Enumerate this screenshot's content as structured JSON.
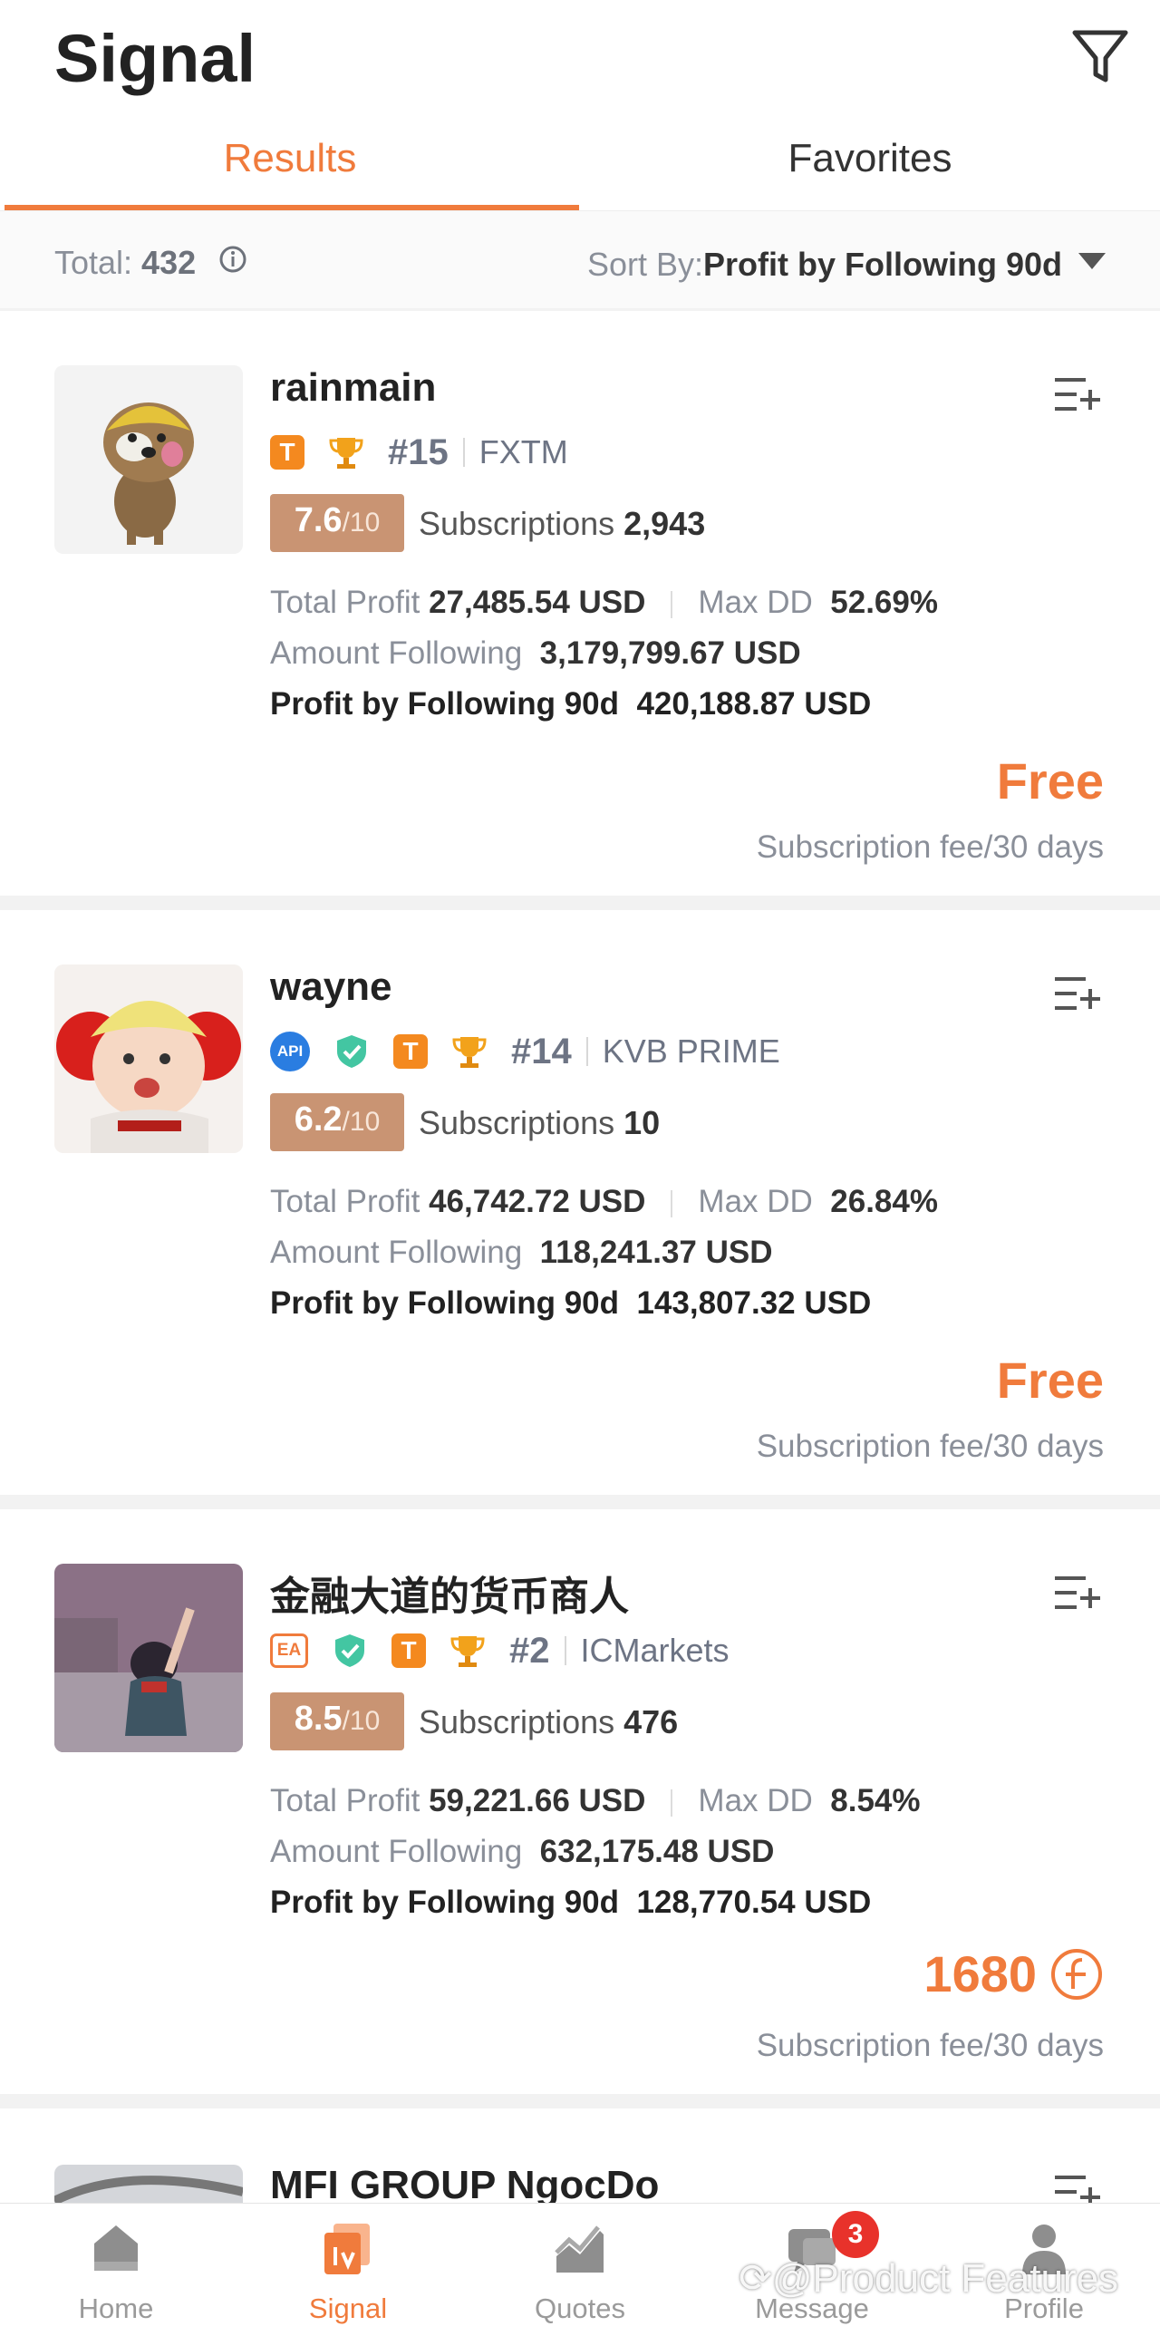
{
  "header": {
    "title": "Signal"
  },
  "tabs": [
    {
      "label": "Results",
      "active": true
    },
    {
      "label": "Favorites",
      "active": false
    }
  ],
  "sortbar": {
    "total_label": "Total: ",
    "total_value": "432",
    "sort_label": "Sort By:",
    "sort_value": "Profit by Following 90d"
  },
  "colors": {
    "accent": "#f07b3c",
    "score_bg": "#c99473",
    "badge_red": "#e8322b"
  },
  "stat_labels": {
    "total_profit": "Total Profit",
    "max_dd": "Max DD",
    "amount_following": "Amount Following",
    "profit_90d": "Profit by Following 90d",
    "subscriptions": "Subscriptions",
    "score_max": "/10",
    "fee": "Subscription fee/30 days"
  },
  "signals": [
    {
      "name": "rainmain",
      "badges": [
        "T",
        "trophy"
      ],
      "rank": "#15",
      "broker": "FXTM",
      "score": "7.6",
      "subscriptions": "2,943",
      "total_profit": "27,485.54 USD",
      "max_dd": "52.69%",
      "amount_following": "3,179,799.67 USD",
      "profit_90d": "420,188.87 USD",
      "price": "Free",
      "avatar": "dog-photo"
    },
    {
      "name": "wayne",
      "badges": [
        "API",
        "shield",
        "T",
        "trophy"
      ],
      "rank": "#14",
      "broker": "KVB PRIME",
      "score": "6.2",
      "subscriptions": "10",
      "total_profit": "46,742.72 USD",
      "max_dd": "26.84%",
      "amount_following": "118,241.37 USD",
      "profit_90d": "143,807.32 USD",
      "price": "Free",
      "avatar": "baby-photo"
    },
    {
      "name": "金融大道的货币商人",
      "badges": [
        "EA",
        "shield",
        "T",
        "trophy"
      ],
      "rank": "#2",
      "broker": "ICMarkets",
      "score": "8.5",
      "subscriptions": "476",
      "total_profit": "59,221.66 USD",
      "max_dd": "8.54%",
      "amount_following": "632,175.48 USD",
      "profit_90d": "128,770.54 USD",
      "price": "1680",
      "price_icon": "coin-icon",
      "avatar": "child-photo"
    },
    {
      "name": "MFI GROUP NgocDo",
      "avatar": "partial-photo"
    }
  ],
  "nav": [
    {
      "label": "Home",
      "icon": "home-icon"
    },
    {
      "label": "Signal",
      "icon": "signal-icon",
      "active": true
    },
    {
      "label": "Quotes",
      "icon": "quotes-icon"
    },
    {
      "label": "Message",
      "icon": "message-icon",
      "badge": "3"
    },
    {
      "label": "Profile",
      "icon": "profile-icon"
    }
  ],
  "watermark": "@Product Features"
}
